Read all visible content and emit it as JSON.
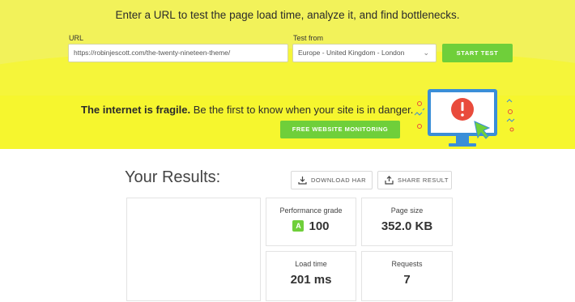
{
  "hero": {
    "headline": "Enter a URL to test the page load time, analyze it, and find bottlenecks.",
    "url_label": "URL",
    "url_value": "https://robinjescott.com/the-twenty-nineteen-theme/",
    "test_from_label": "Test from",
    "test_from_value": "Europe - United Kingdom - London",
    "start_button": "START TEST"
  },
  "promo": {
    "bold": "The internet is fragile.",
    "text": " Be the first to know when your site is in danger.",
    "button": "FREE WEBSITE MONITORING"
  },
  "results": {
    "title": "Your Results:",
    "download_button": "DOWNLOAD HAR",
    "share_button": "SHARE RESULT",
    "metrics": {
      "performance": {
        "label": "Performance grade",
        "grade": "A",
        "value": "100"
      },
      "page_size": {
        "label": "Page size",
        "value": "352.0 KB"
      },
      "load_time": {
        "label": "Load time",
        "value": "201 ms"
      },
      "requests": {
        "label": "Requests",
        "value": "7"
      }
    }
  },
  "colors": {
    "yellow": "#f5f53a",
    "green": "#6fcf3a",
    "alert_red": "#e94b3c",
    "monitor_blue": "#3a8ed8"
  }
}
